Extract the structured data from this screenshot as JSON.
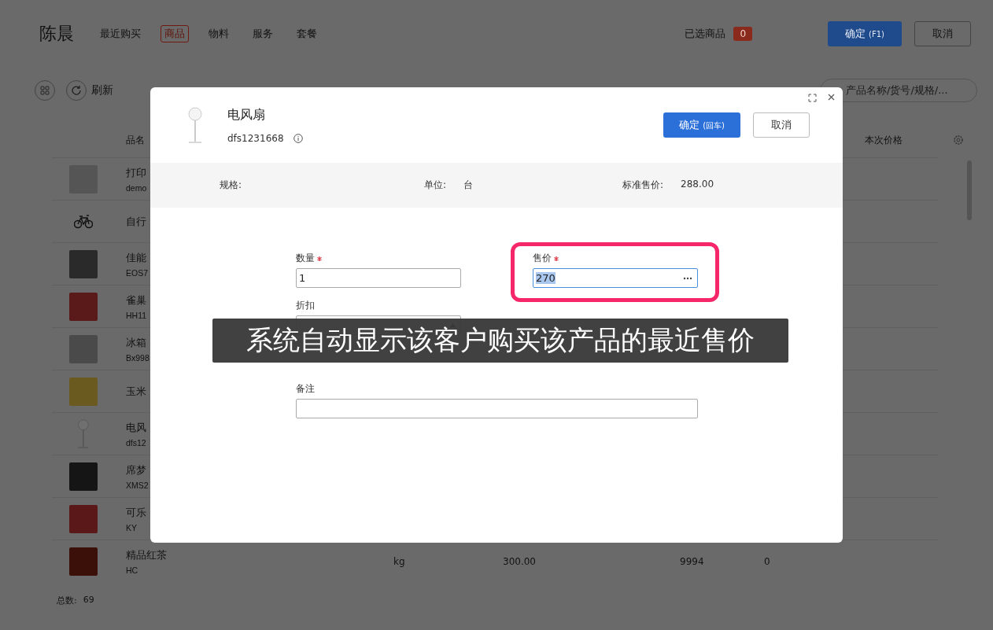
{
  "header": {
    "customer": "陈晨",
    "tabs": [
      {
        "label": "最近购买",
        "selected": false
      },
      {
        "label": "商品",
        "selected": true
      },
      {
        "label": "物料",
        "selected": false
      },
      {
        "label": "服务",
        "selected": false
      },
      {
        "label": "套餐",
        "selected": false
      }
    ],
    "selected_label": "已选商品",
    "selected_count": "0",
    "confirm": {
      "label": "确定",
      "shortcut": "(F1)"
    },
    "cancel": "取消"
  },
  "toolbar": {
    "refresh": "刷新",
    "search_placeholder": "产品名称/货号/规格/..."
  },
  "table": {
    "columns": [
      "品名",
      "本次价格"
    ],
    "rows": [
      {
        "name": "打印",
        "code": "demo"
      },
      {
        "name": "自行"
      },
      {
        "name": "佳能",
        "code": "EOS7"
      },
      {
        "name": "雀巢",
        "code": "HH11"
      },
      {
        "name": "冰箱",
        "code": "Bx998"
      },
      {
        "name": "玉米"
      },
      {
        "name": "电风",
        "code": "dfs12"
      },
      {
        "name": "席梦",
        "code": "XMS2"
      },
      {
        "name": "可乐",
        "code": "KY"
      },
      {
        "name": "精品红茶",
        "code": "HC",
        "unit": "kg",
        "price": "300.00",
        "stock": "9994",
        "column_6": "0"
      }
    ]
  },
  "footer": {
    "total_label": "总数:",
    "total": "69"
  },
  "dialog": {
    "product": "电风扇",
    "code": "dfs1231668",
    "confirm": {
      "label": "确定",
      "shortcut": "(回车)"
    },
    "cancel": "取消",
    "info": [
      {
        "label": "规格:"
      },
      {
        "label": "单位:",
        "value": "台"
      },
      {
        "label": "标准售价:",
        "value": "288.00"
      }
    ],
    "fields": [
      {
        "label": "数量",
        "required": true,
        "value": "1",
        "kind": "text",
        "highlighted": false
      },
      {
        "label": "售价",
        "required": true,
        "value": "270",
        "kind": "picker",
        "highlighted": true,
        "text_selected": true
      },
      {
        "label": "折扣",
        "required": false,
        "kind": "number",
        "highlighted": false
      },
      {
        "label": "备注",
        "required": false,
        "kind": "wide",
        "highlighted": false
      }
    ]
  },
  "caption": "系统自动显示该客户购买该产品的最近售价"
}
